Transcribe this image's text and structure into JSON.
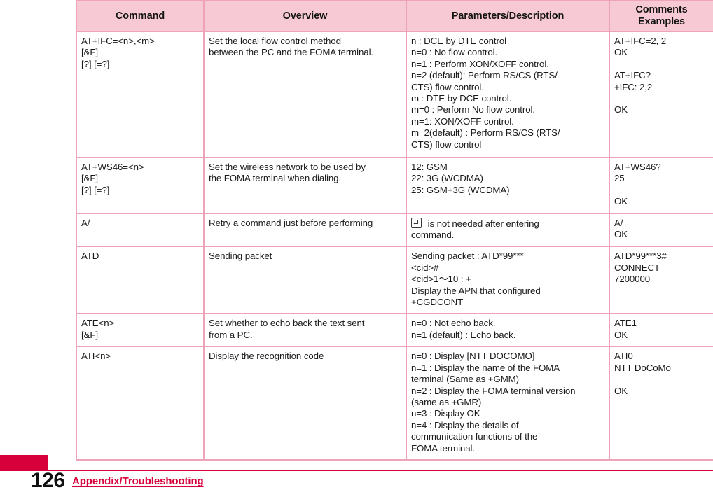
{
  "document": {
    "page_number": "126",
    "section_title": "Appendix/Troubleshooting",
    "accent_color": "#D7003A",
    "table_header_fill": "#F7C9D4",
    "table_border_color": "#EFA3B8"
  },
  "table": {
    "columns": [
      {
        "label": "Command"
      },
      {
        "label": "Overview"
      },
      {
        "label": "Parameters/Description"
      },
      {
        "label": "Comments\nExamples"
      }
    ],
    "rows": [
      {
        "command": "AT+IFC=<n>,<m>\n[&F]\n[?] [=?]",
        "overview": "Set the local flow control method\nbetween the PC and the FOMA terminal.",
        "parameters": "n : DCE by DTE control\nn=0 : No flow control.\nn=1 : Perform XON/XOFF control.\nn=2 (default): Perform RS/CS (RTS/\n    CTS) flow control.\nm : DTE by DCE control.\nm=0 : Perform No flow control.\nm=1: XON/XOFF control.\nm=2(default) : Perform RS/CS (RTS/\n    CTS) flow control",
        "comments": "AT+IFC=2, 2\nOK\n\nAT+IFC?\n+IFC: 2,2\n\nOK"
      },
      {
        "command": "AT+WS46=<n>\n[&F]\n[?] [=?]",
        "overview": "Set the wireless network to be used by\nthe FOMA terminal when dialing.",
        "parameters": "12: GSM\n22: 3G (WCDMA)\n25: GSM+3G (WCDMA)",
        "comments": "AT+WS46?\n25\n\nOK"
      },
      {
        "command": "A/",
        "overview": "Retry a command just before performing",
        "parameters_icon": "enter-key-icon",
        "parameters_line1": " is not needed after entering",
        "parameters_line2": "command.",
        "comments": "A/\nOK"
      },
      {
        "command": "ATD",
        "overview": "Sending packet",
        "parameters": "Sending packet : ATD*99***\n<cid>#\n<cid>1～10 : +\nDisplay the APN that configured\n+CGDCONT",
        "comments": "ATD*99***3#\nCONNECT\n7200000"
      },
      {
        "command": "ATE<n>\n[&F]",
        "overview": "Set whether to echo back the text sent\nfrom a PC.",
        "parameters": "n=0 : Not echo back.\nn=1  (default) : Echo back.",
        "comments": "ATE1\nOK"
      },
      {
        "command": "ATI<n>",
        "overview": "Display the recognition code",
        "parameters": "n=0 : Display [NTT DOCOMO]\nn=1 : Display the name of the FOMA\n     terminal  (Same as +GMM)\nn=2 : Display the FOMA terminal version\n     (same as +GMR)\nn=3 : Display OK\nn=4 : Display the details of\n     communication functions of the\n     FOMA terminal.",
        "comments": "ATI0\nNTT DoCoMo\n\nOK"
      }
    ]
  }
}
